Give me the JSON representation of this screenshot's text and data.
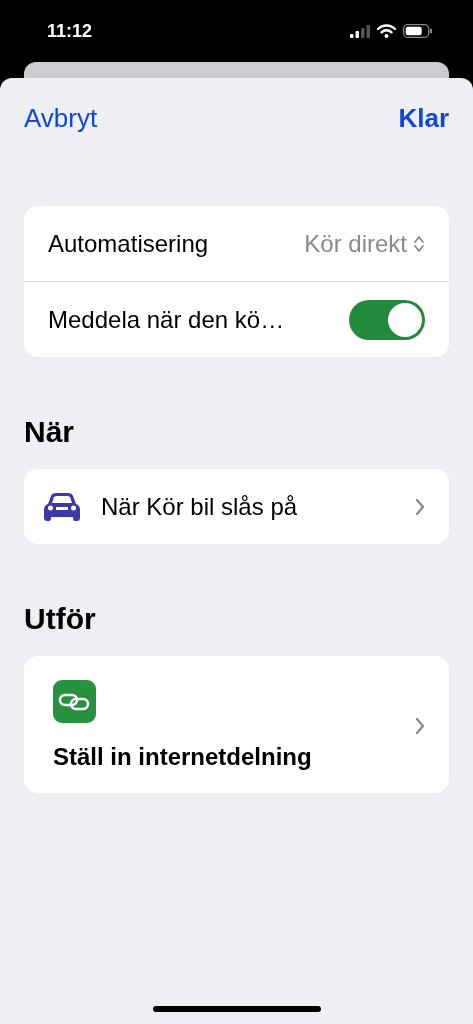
{
  "status_bar": {
    "time": "11:12"
  },
  "nav": {
    "cancel": "Avbryt",
    "done": "Klar"
  },
  "settings": [
    {
      "kind": "picker",
      "label": "Automatisering",
      "value": "Kör direkt"
    },
    {
      "kind": "toggle",
      "label": "Meddela när den kö…",
      "on": true
    }
  ],
  "trigger": {
    "title": "När",
    "label": "När Kör bil slås på"
  },
  "action": {
    "title": "Utför",
    "label": "Ställ in internetdelning"
  }
}
